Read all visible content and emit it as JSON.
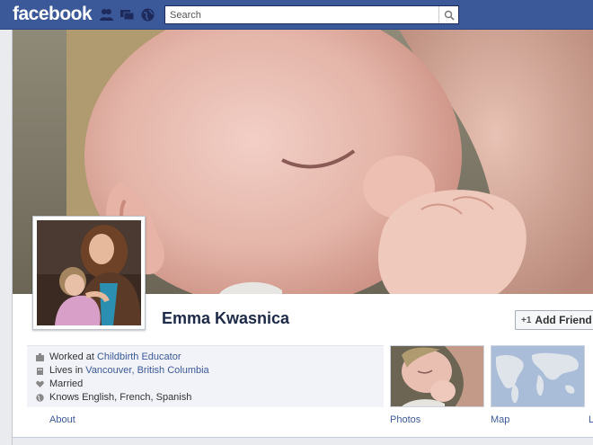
{
  "header": {
    "logo": "facebook",
    "search_placeholder": "Search",
    "icons": [
      "friend-requests-icon",
      "messages-icon",
      "notifications-icon",
      "search-icon"
    ]
  },
  "profile": {
    "name": "Emma Kwasnica",
    "add_friend_label": "Add Friend",
    "cover_photo": "baby-sleeping-photo",
    "profile_photo": "woman-holding-child-photo"
  },
  "about": {
    "worked_prefix": "Worked at ",
    "worked_link": "Childbirth Educator",
    "lives_prefix": "Lives in ",
    "lives_link": "Vancouver, British Columbia",
    "married": "Married",
    "knows": "Knows English, French, Spanish"
  },
  "tabs": {
    "about": "About",
    "photos": "Photos",
    "map": "Map",
    "partial": "L"
  },
  "colors": {
    "brand": "#3b5998",
    "link": "#3b5998",
    "name": "#1c2a47"
  }
}
